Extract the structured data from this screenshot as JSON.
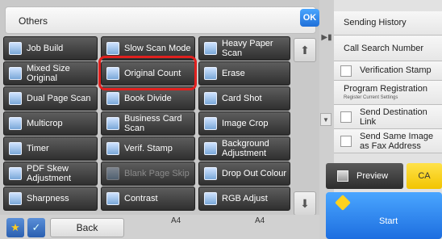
{
  "header": {
    "title": "Others",
    "ok_label": "OK"
  },
  "grid": {
    "rows": [
      [
        {
          "label": "Job Build",
          "icon": "job-build-icon"
        },
        {
          "label": "Slow Scan Mode",
          "icon": "slow-scan-icon"
        },
        {
          "label": "Heavy Paper Scan",
          "icon": "heavy-paper-icon"
        }
      ],
      [
        {
          "label": "Mixed Size Original",
          "icon": "mixed-size-icon"
        },
        {
          "label": "Original Count",
          "icon": "original-count-icon"
        },
        {
          "label": "Erase",
          "icon": "erase-icon"
        }
      ],
      [
        {
          "label": "Dual Page Scan",
          "icon": "dual-page-icon"
        },
        {
          "label": "Book Divide",
          "icon": "book-divide-icon"
        },
        {
          "label": "Card Shot",
          "icon": "card-shot-icon"
        }
      ],
      [
        {
          "label": "Multicrop",
          "icon": "multicrop-icon"
        },
        {
          "label": "Business Card Scan",
          "icon": "business-card-icon"
        },
        {
          "label": "Image Crop",
          "icon": "image-crop-icon"
        }
      ],
      [
        {
          "label": "Timer",
          "icon": "timer-icon"
        },
        {
          "label": "Verif. Stamp",
          "icon": "verif-stamp-icon"
        },
        {
          "label": "Background Adjustment",
          "icon": "background-adjust-icon"
        }
      ],
      [
        {
          "label": "PDF Skew Adjustment",
          "icon": "pdf-skew-icon"
        },
        {
          "label": "Blank Page Skip",
          "icon": "blank-page-icon"
        },
        {
          "label": "Drop Out Colour",
          "icon": "drop-out-icon"
        }
      ],
      [
        {
          "label": "Sharpness",
          "icon": "sharpness-icon"
        },
        {
          "label": "Contrast",
          "icon": "contrast-icon"
        },
        {
          "label": "RGB Adjust",
          "icon": "rgb-adjust-icon"
        }
      ]
    ],
    "l_0_0": "Job Build",
    "l_0_1": "Slow Scan Mode",
    "l_0_2": "Heavy Paper Scan",
    "l_1_0": "Mixed Size Original",
    "l_1_1": "Original Count",
    "l_1_2": "Erase",
    "l_2_0": "Dual Page Scan",
    "l_2_1": "Book Divide",
    "l_2_2": "Card Shot",
    "l_3_0": "Multicrop",
    "l_3_1": "Business Card Scan",
    "l_3_2": "Image Crop",
    "l_4_0": "Timer",
    "l_4_1": "Verif. Stamp",
    "l_4_2": "Background Adjustment",
    "l_5_0": "PDF Skew Adjustment",
    "l_5_1": "Blank Page Skip",
    "l_5_2": "Drop Out Colour",
    "l_6_0": "Sharpness",
    "l_6_1": "Contrast",
    "l_6_2": "RGB Adjust",
    "highlighted": "Original Count",
    "disabled": "Blank Page Skip"
  },
  "scroll": {
    "up_icon": "double-chevron-up-icon",
    "down_icon": "double-chevron-down-icon"
  },
  "bottom": {
    "back_label": "Back",
    "paper_left": "A4",
    "paper_right": "A4"
  },
  "right_panel": {
    "sending_history": "Sending History",
    "call_search_number": "Call Search Number",
    "verification_stamp": "Verification Stamp",
    "program_registration": "Program Registration",
    "program_registration_sub": "Register Current Settings",
    "send_destination_link": "Send Destination Link",
    "send_same_image": "Send Same Image as Fax Address",
    "preview_label": "Preview",
    "ca_label": "CA",
    "start_label": "Start"
  },
  "colors": {
    "ok_blue": "#1f6fd8",
    "highlight_red": "#e0201e",
    "ca_yellow": "#f2c400",
    "start_blue": "#1d6ee0"
  }
}
